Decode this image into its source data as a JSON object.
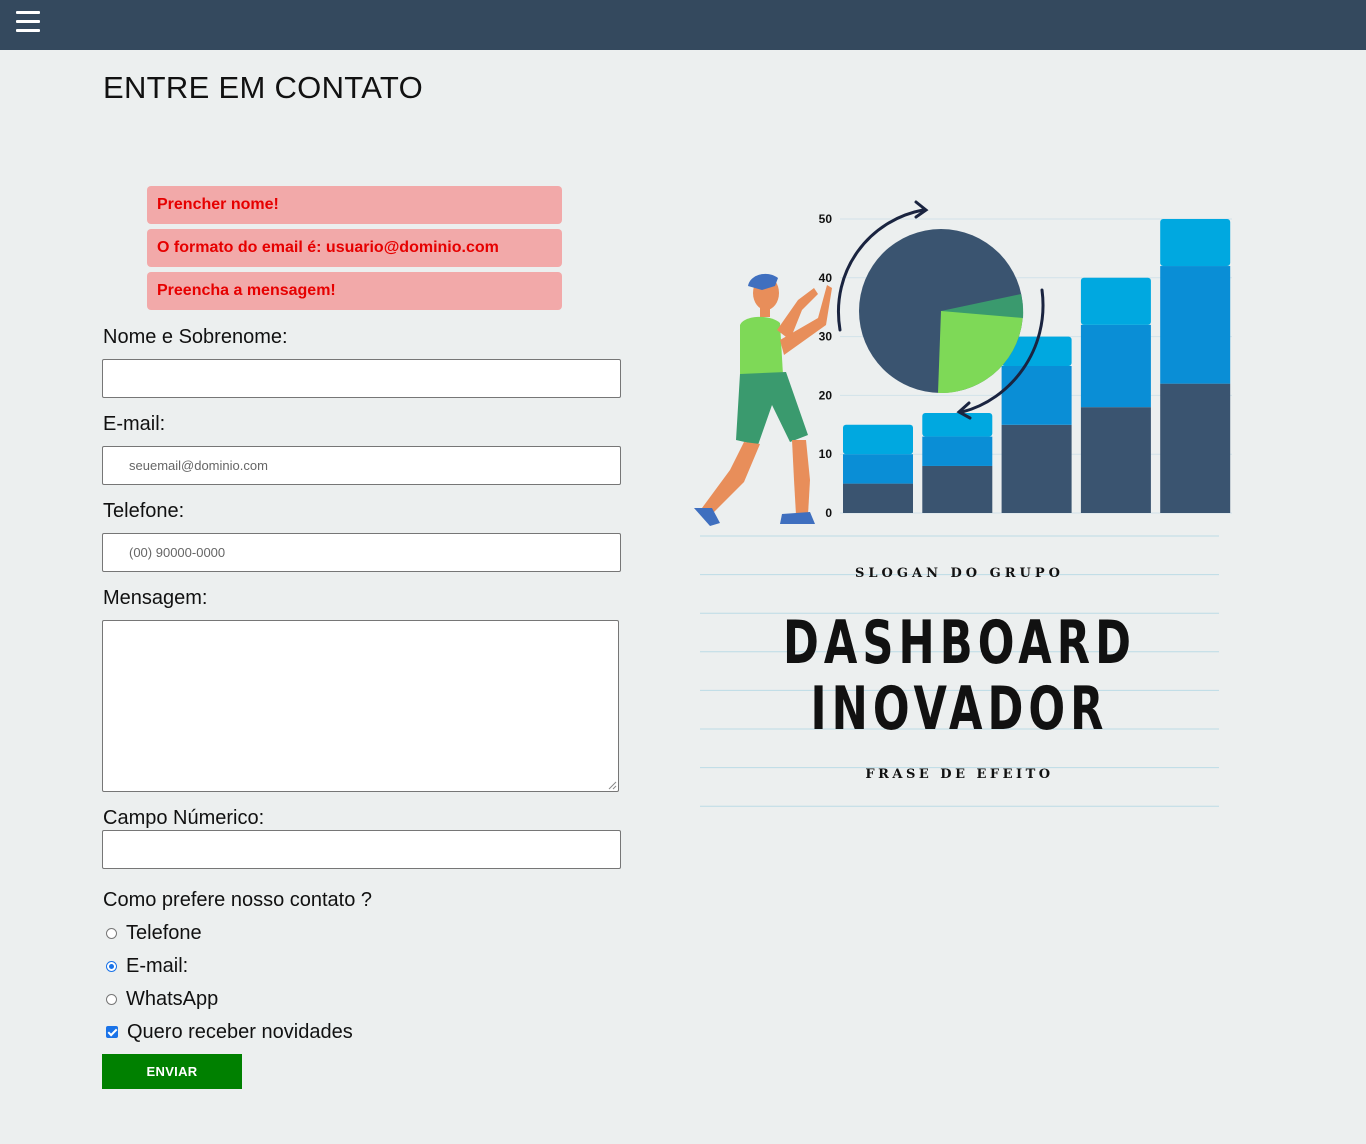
{
  "header": {
    "menu_icon": "hamburger-icon",
    "bg_color": "#34495e"
  },
  "page": {
    "title": "ENTRE EM CONTATO"
  },
  "errors": [
    "Prencher nome!",
    "O formato do email é: usuario@dominio.com",
    "Preencha a mensagem!"
  ],
  "form": {
    "name_label": "Nome e Sobrenome:",
    "name_value": "",
    "email_label": "E-mail:",
    "email_placeholder": "seuemail@dominio.com",
    "phone_label": "Telefone:",
    "phone_placeholder": "(00) 90000-0000",
    "message_label": "Mensagem:",
    "number_label": "Campo Númerico:",
    "contact_question": "Como prefere nosso contato ?",
    "contact_options": [
      {
        "label": "Telefone",
        "checked": false
      },
      {
        "label": "E-mail:",
        "checked": true
      },
      {
        "label": "WhatsApp",
        "checked": false
      }
    ],
    "newsletter_label": "Quero receber novidades",
    "newsletter_checked": true,
    "submit_label": "ENVIAR",
    "submit_color": "#008000"
  },
  "poster": {
    "slogan": "SLOGAN DO GRUPO",
    "title_line1": "DASHBOARD",
    "title_line2": "INOVADOR",
    "tagline": "FRASE DE EFEITO",
    "chart_data": {
      "type": "bar",
      "stacked": true,
      "categories": [
        "",
        "",
        "",
        "",
        ""
      ],
      "yticks": [
        "0",
        "10",
        "20",
        "30",
        "40",
        "50"
      ],
      "ylim": [
        0,
        50
      ],
      "series": [
        {
          "values": [
            5,
            8,
            15,
            18,
            22
          ]
        },
        {
          "values": [
            5,
            5,
            10,
            14,
            20
          ]
        },
        {
          "values": [
            5,
            4,
            5,
            8,
            8
          ]
        }
      ],
      "colors": [
        "#3a5470",
        "#0a8ed6",
        "#00a8e0"
      ]
    }
  }
}
